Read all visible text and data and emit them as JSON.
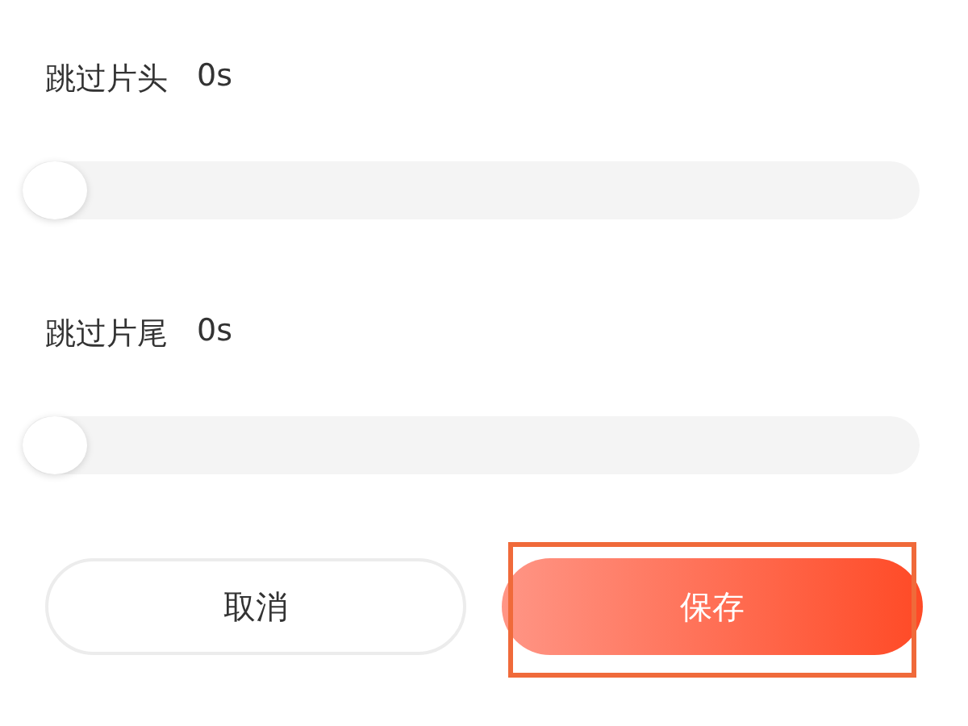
{
  "settings": [
    {
      "label": "跳过片头",
      "value": "0s",
      "level": 0
    },
    {
      "label": "跳过片尾",
      "value": "0s",
      "level": 0
    }
  ],
  "buttons": [
    {
      "label": "取消",
      "kind": "outline",
      "highlighted": false
    },
    {
      "label": "保存",
      "kind": "primary",
      "highlighted": true
    }
  ]
}
